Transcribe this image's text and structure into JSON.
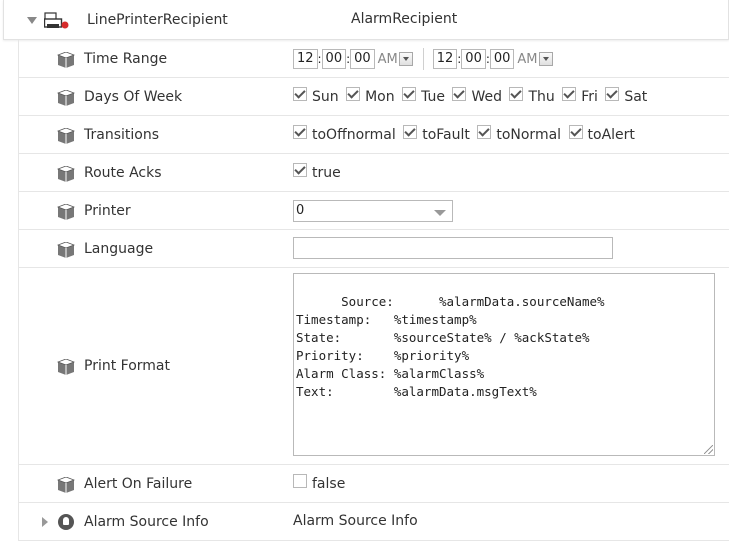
{
  "header": {
    "name": "LinePrinterRecipient",
    "type": "AlarmRecipient"
  },
  "time_range": {
    "label": "Time Range",
    "start": {
      "hour": "12",
      "minute": "00",
      "second": "00",
      "ampm": "AM"
    },
    "end": {
      "hour": "12",
      "minute": "00",
      "second": "00",
      "ampm": "AM"
    }
  },
  "days_of_week": {
    "label": "Days Of Week",
    "items": [
      {
        "label": "Sun",
        "checked": true
      },
      {
        "label": "Mon",
        "checked": true
      },
      {
        "label": "Tue",
        "checked": true
      },
      {
        "label": "Wed",
        "checked": true
      },
      {
        "label": "Thu",
        "checked": true
      },
      {
        "label": "Fri",
        "checked": true
      },
      {
        "label": "Sat",
        "checked": true
      }
    ]
  },
  "transitions": {
    "label": "Transitions",
    "items": [
      {
        "label": "toOffnormal",
        "checked": true
      },
      {
        "label": "toFault",
        "checked": true
      },
      {
        "label": "toNormal",
        "checked": true
      },
      {
        "label": "toAlert",
        "checked": true
      }
    ]
  },
  "route_acks": {
    "label": "Route Acks",
    "value": "true",
    "checked": true
  },
  "printer": {
    "label": "Printer",
    "value": "0"
  },
  "language": {
    "label": "Language",
    "value": ""
  },
  "print_format": {
    "label": "Print Format",
    "value": "Source:      %alarmData.sourceName%\nTimestamp:   %timestamp%\nState:       %sourceState% / %ackState%\nPriority:    %priority%\nAlarm Class: %alarmClass%\nText:        %alarmData.msgText%"
  },
  "alert_on_failure": {
    "label": "Alert On Failure",
    "value": "false",
    "checked": false
  },
  "alarm_source_info": {
    "label": "Alarm Source Info",
    "value": "Alarm Source Info"
  }
}
